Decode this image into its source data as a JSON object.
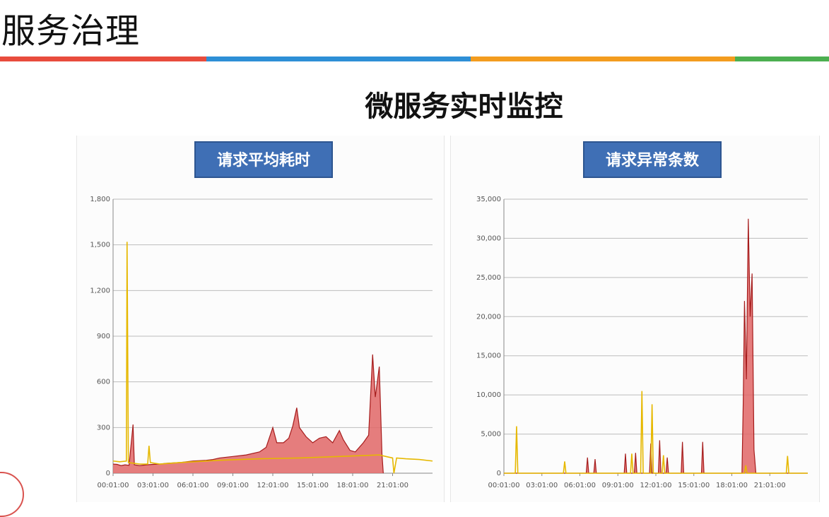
{
  "page": {
    "title": "服务治理",
    "heading": "微服务实时监控",
    "accent_colors": [
      "#e84c3d",
      "#2e8fd6",
      "#f39c1f",
      "#4caf50"
    ]
  },
  "chart_data": [
    {
      "type": "area",
      "title": "请求平均耗时",
      "xlabel": "",
      "ylabel": "",
      "ylim": [
        0,
        1800
      ],
      "yticks": [
        "1,800",
        "1,500",
        "1,200",
        "900",
        "600",
        "300",
        "0"
      ],
      "xticks": [
        "00:01:00",
        "03:01:00",
        "06:01:00",
        "09:01:00",
        "12:01:00",
        "15:01:00",
        "18:01:00",
        "21:01:00"
      ],
      "grid": true,
      "series": [
        {
          "color": "#e06666",
          "stroke": "#a61c1c",
          "points": [
            [
              0,
              60
            ],
            [
              0.3,
              58
            ],
            [
              0.6,
              50
            ],
            [
              0.9,
              55
            ],
            [
              1.2,
              52
            ],
            [
              1.5,
              320
            ],
            [
              1.6,
              55
            ],
            [
              2,
              50
            ],
            [
              2.5,
              55
            ],
            [
              3,
              58
            ],
            [
              3.5,
              60
            ],
            [
              4,
              65
            ],
            [
              5,
              70
            ],
            [
              6,
              80
            ],
            [
              7,
              85
            ],
            [
              7.5,
              90
            ],
            [
              8,
              100
            ],
            [
              9,
              110
            ],
            [
              10,
              120
            ],
            [
              11,
              140
            ],
            [
              11.5,
              170
            ],
            [
              12,
              300
            ],
            [
              12.3,
              200
            ],
            [
              12.8,
              200
            ],
            [
              13.2,
              230
            ],
            [
              13.5,
              310
            ],
            [
              13.8,
              430
            ],
            [
              14,
              300
            ],
            [
              14.5,
              240
            ],
            [
              15,
              200
            ],
            [
              15.5,
              230
            ],
            [
              16,
              240
            ],
            [
              16.5,
              200
            ],
            [
              17,
              280
            ],
            [
              17.3,
              220
            ],
            [
              17.8,
              150
            ],
            [
              18.2,
              140
            ],
            [
              18.8,
              200
            ],
            [
              19.2,
              250
            ],
            [
              19.5,
              780
            ],
            [
              19.7,
              500
            ],
            [
              20,
              700
            ],
            [
              20.2,
              130
            ],
            [
              20.3,
              0
            ]
          ]
        },
        {
          "color": "#e6b800",
          "stroke": "#e6b800",
          "points": [
            [
              0,
              80
            ],
            [
              0.5,
              75
            ],
            [
              1,
              80
            ],
            [
              1.05,
              1520
            ],
            [
              1.15,
              70
            ],
            [
              2,
              60
            ],
            [
              2.6,
              60
            ],
            [
              2.7,
              180
            ],
            [
              2.8,
              70
            ],
            [
              3.5,
              60
            ],
            [
              5,
              70
            ],
            [
              8,
              85
            ],
            [
              11,
              95
            ],
            [
              14,
              100
            ],
            [
              17,
              110
            ],
            [
              20,
              120
            ],
            [
              20.5,
              110
            ],
            [
              21,
              100
            ],
            [
              21.1,
              0
            ],
            [
              21.3,
              100
            ],
            [
              22,
              95
            ],
            [
              23,
              90
            ],
            [
              24,
              80
            ]
          ]
        }
      ]
    },
    {
      "type": "area",
      "title": "请求异常条数",
      "xlabel": "",
      "ylabel": "",
      "ylim": [
        0,
        35000
      ],
      "yticks": [
        "35,000",
        "30,000",
        "25,000",
        "20,000",
        "15,000",
        "10,000",
        "5,000",
        "0"
      ],
      "xticks": [
        "00:01:00",
        "03:01:00",
        "06:01:00",
        "09:01:00",
        "12:01:00",
        "15:01:00",
        "18:01:00",
        "21:01:00"
      ],
      "grid": true,
      "series": [
        {
          "color": "#e06666",
          "stroke": "#a61c1c",
          "points": [
            [
              0,
              0
            ],
            [
              6.5,
              0
            ],
            [
              6.6,
              2000
            ],
            [
              6.7,
              0
            ],
            [
              7.1,
              0
            ],
            [
              7.2,
              1800
            ],
            [
              7.3,
              0
            ],
            [
              9.5,
              0
            ],
            [
              9.6,
              2500
            ],
            [
              9.7,
              0
            ],
            [
              10.3,
              0
            ],
            [
              10.4,
              2600
            ],
            [
              10.5,
              0
            ],
            [
              11.5,
              0
            ],
            [
              11.6,
              3800
            ],
            [
              11.7,
              0
            ],
            [
              12.2,
              0
            ],
            [
              12.3,
              4200
            ],
            [
              12.4,
              0
            ],
            [
              12.8,
              0
            ],
            [
              12.9,
              2000
            ],
            [
              13,
              0
            ],
            [
              14,
              0
            ],
            [
              14.1,
              4000
            ],
            [
              14.2,
              0
            ],
            [
              15.6,
              0
            ],
            [
              15.7,
              4000
            ],
            [
              15.8,
              0
            ],
            [
              18.8,
              0
            ],
            [
              18.9,
              9000
            ],
            [
              19.0,
              22000
            ],
            [
              19.15,
              12000
            ],
            [
              19.3,
              32500
            ],
            [
              19.45,
              20000
            ],
            [
              19.6,
              25500
            ],
            [
              19.75,
              3000
            ],
            [
              19.9,
              0
            ],
            [
              24,
              0
            ]
          ]
        },
        {
          "color": "#e6b800",
          "stroke": "#e6b800",
          "points": [
            [
              0,
              0
            ],
            [
              0.9,
              0
            ],
            [
              1,
              6000
            ],
            [
              1.1,
              0
            ],
            [
              4.7,
              0
            ],
            [
              4.8,
              1500
            ],
            [
              4.9,
              0
            ],
            [
              10,
              0
            ],
            [
              10.1,
              2500
            ],
            [
              10.2,
              0
            ],
            [
              10.8,
              0
            ],
            [
              10.9,
              10500
            ],
            [
              11,
              0
            ],
            [
              11.6,
              0
            ],
            [
              11.7,
              8800
            ],
            [
              11.8,
              0
            ],
            [
              12.5,
              0
            ],
            [
              12.6,
              2300
            ],
            [
              12.7,
              0
            ],
            [
              19,
              0
            ],
            [
              19.1,
              1000
            ],
            [
              19.2,
              0
            ],
            [
              22.3,
              0
            ],
            [
              22.4,
              2200
            ],
            [
              22.5,
              0
            ],
            [
              24,
              0
            ]
          ]
        }
      ]
    }
  ]
}
